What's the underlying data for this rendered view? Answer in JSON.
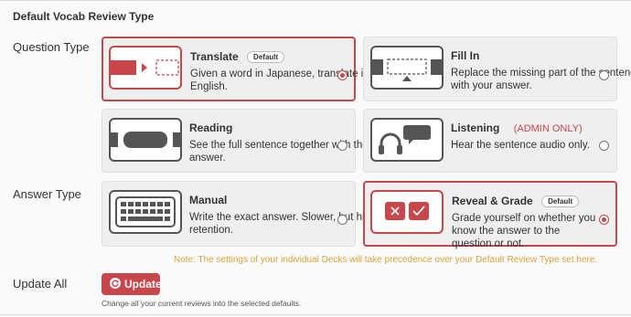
{
  "section_title": "Default Vocab Review Type",
  "labels": {
    "question_type": "Question Type",
    "answer_type": "Answer Type",
    "update_all": "Update All"
  },
  "question_types": [
    {
      "title": "Translate",
      "badge": "Default",
      "desc": "Given a word in Japanese, translate it to English.",
      "selected": true
    },
    {
      "title": "Fill In",
      "desc": "Replace the missing part of the sentence with your answer.",
      "selected": false
    },
    {
      "title": "Reading",
      "desc": "See the full sentence together with the answer.",
      "selected": false
    },
    {
      "title": "Listening",
      "note": "(ADMIN ONLY)",
      "desc": "Hear the sentence audio only.",
      "selected": false
    }
  ],
  "answer_types": [
    {
      "title": "Manual",
      "desc": "Write the exact answer. Slower, but higher retention.",
      "selected": false
    },
    {
      "title": "Reveal & Grade",
      "badge": "Default",
      "desc": "Grade yourself on whether you know the answer to the question or not.",
      "selected": true
    }
  ],
  "note": "Note: The settings of your individual Decks will take precedence over your Default Review Type set here.",
  "update": {
    "label": "Update",
    "help": "Change all your current reviews into the selected defaults."
  },
  "colors": {
    "accent": "#c9474b",
    "note": "#e0a23a",
    "card_bg": "#efefef"
  },
  "icons": [
    "translate-icon",
    "fill-in-icon",
    "reading-icon",
    "listening-icon",
    "keyboard-icon",
    "reveal-grade-icon",
    "refresh-icon"
  ]
}
